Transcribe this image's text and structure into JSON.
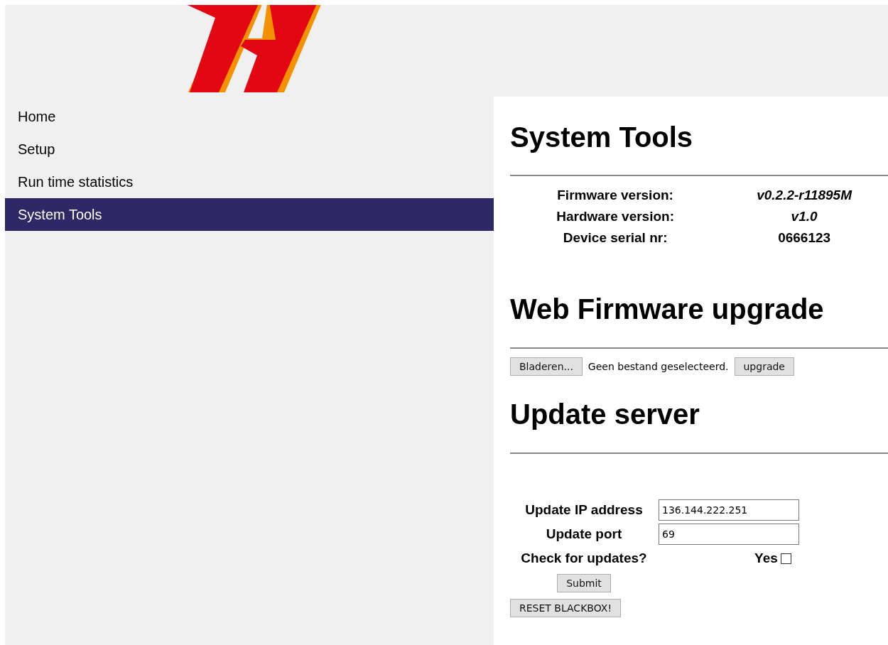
{
  "nav": {
    "items": [
      {
        "label": "Home",
        "selected": false
      },
      {
        "label": "Setup",
        "selected": false
      },
      {
        "label": "Run time statistics",
        "selected": false
      },
      {
        "label": "System Tools",
        "selected": true
      }
    ]
  },
  "page_title": "System Tools",
  "info": [
    {
      "label": "Firmware version:",
      "value": "v0.2.2-r11895M",
      "kind": "italic"
    },
    {
      "label": "Hardware version:",
      "value": "v1.0",
      "kind": "italic"
    },
    {
      "label": "Device serial nr:",
      "value": "0666123",
      "kind": "plain"
    }
  ],
  "upgrade": {
    "heading": "Web Firmware upgrade",
    "browse_button": "Bladeren...",
    "file_status": "Geen bestand geselecteerd.",
    "upgrade_button": "upgrade"
  },
  "update_server": {
    "heading": "Update server",
    "fields": [
      {
        "label": "Update IP address",
        "value": "136.144.222.251"
      },
      {
        "label": "Update port",
        "value": "69"
      }
    ],
    "check": {
      "label": "Check for updates?",
      "option": "Yes",
      "checked": false
    },
    "submit_button": "Submit",
    "reset_button": "RESET BLACKBOX!"
  }
}
